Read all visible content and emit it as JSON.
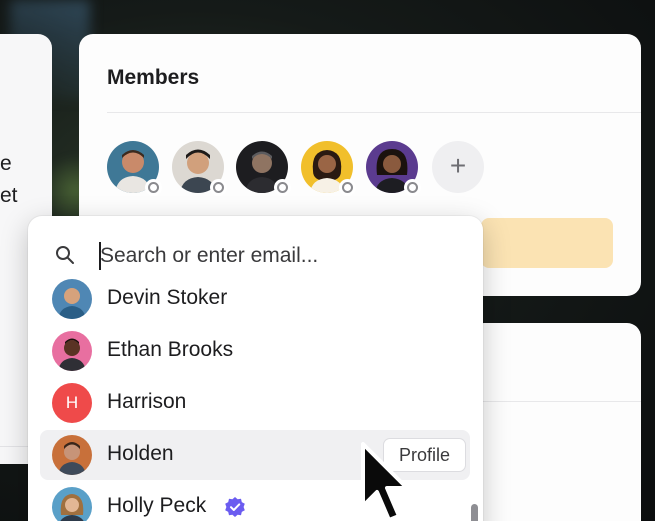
{
  "left_panel": {
    "lines": [
      "e",
      "et"
    ]
  },
  "members": {
    "title": "Members",
    "avatars": [
      {
        "name": "member-1",
        "status": "offline",
        "bg": "#2f6b8a"
      },
      {
        "name": "member-2",
        "status": "offline",
        "bg": "#d9d4cf"
      },
      {
        "name": "member-3",
        "status": "offline",
        "bg": "#1b1b1d"
      },
      {
        "name": "member-4",
        "status": "offline",
        "bg": "#f2c230"
      },
      {
        "name": "member-5",
        "status": "offline",
        "bg": "#5a3b8c"
      }
    ],
    "add_icon": "plus-icon",
    "add_symbol": "+"
  },
  "dropdown": {
    "search": {
      "placeholder": "Search or enter email...",
      "value": "",
      "icon": "search-icon"
    },
    "items": [
      {
        "label": "Devin Stoker",
        "avatar": "photo"
      },
      {
        "label": "Ethan Brooks",
        "avatar": "photo"
      },
      {
        "label": "Harrison",
        "avatar": "initial",
        "initial": "H"
      },
      {
        "label": "Holden",
        "avatar": "photo",
        "hover": true,
        "action": "Profile"
      },
      {
        "label": "Holly Peck",
        "avatar": "photo",
        "verified": true
      }
    ]
  },
  "colors": {
    "accent_verified": "#6b5cf0",
    "initial_avatar": "#ef4a4a",
    "highlight_bar": "#fbe3b3"
  }
}
